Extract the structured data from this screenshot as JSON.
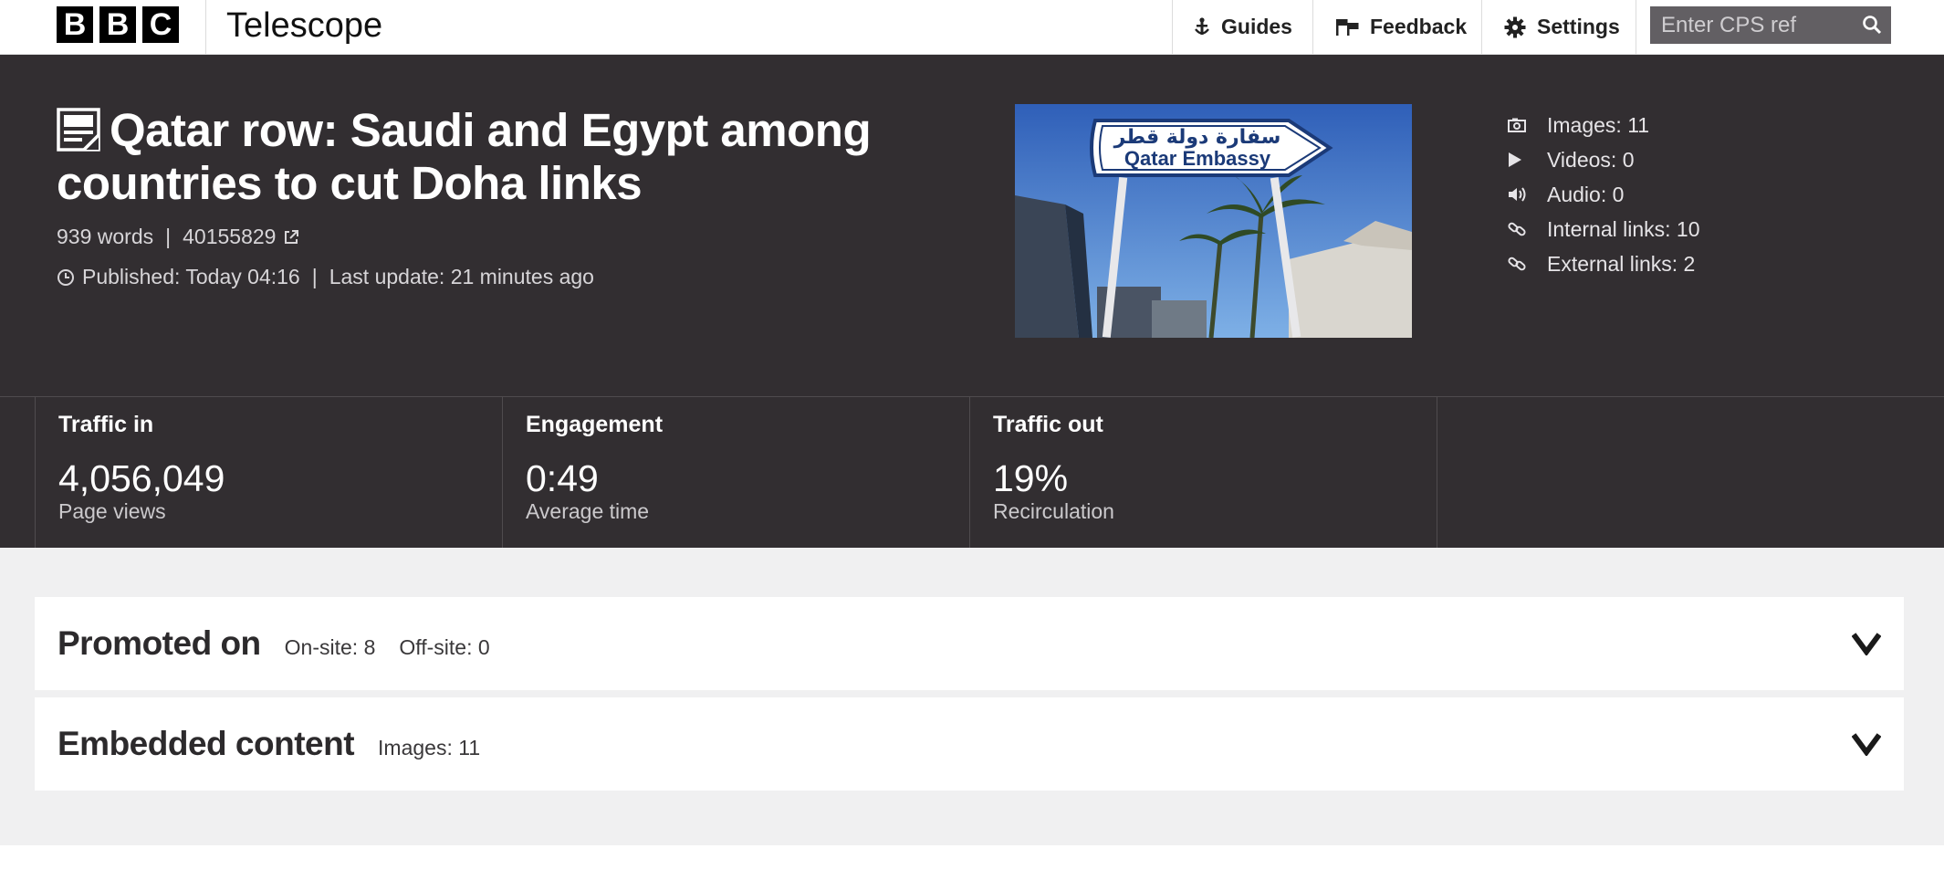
{
  "brand": {
    "letters": [
      "B",
      "B",
      "C"
    ],
    "app_name": "Telescope"
  },
  "nav": {
    "guides": {
      "label": "Guides",
      "icon": "guide-icon"
    },
    "feedback": {
      "label": "Feedback",
      "icon": "feedback-flags-icon"
    },
    "settings": {
      "label": "Settings",
      "icon": "gear-icon"
    }
  },
  "search": {
    "placeholder": "Enter CPS ref",
    "value": "",
    "icon": "search-icon"
  },
  "article": {
    "title": "Qatar row: Saudi and Egypt among countries to cut Doha links",
    "words": "939 words",
    "separator": "|",
    "asset_id": "40155829",
    "published": "Published: Today 04:16",
    "last_update": "Last update: 21 minutes ago",
    "image_sign_arabic": "سفارة دولة قطر",
    "image_sign_english": "Qatar Embassy"
  },
  "asset_stats": [
    {
      "icon": "camera-icon",
      "label": "Images: 11"
    },
    {
      "icon": "play-icon",
      "label": "Videos: 0"
    },
    {
      "icon": "speaker-icon",
      "label": "Audio: 0"
    },
    {
      "icon": "link-icon",
      "label": "Internal links: 10"
    },
    {
      "icon": "link-icon",
      "label": "External links: 2"
    }
  ],
  "metrics": [
    {
      "title": "Traffic in",
      "value": "4,056,049",
      "caption": "Page views"
    },
    {
      "title": "Engagement",
      "value": "0:49",
      "caption": "Average time"
    },
    {
      "title": "Traffic out",
      "value": "19%",
      "caption": "Recirculation"
    }
  ],
  "panels": {
    "promoted": {
      "title": "Promoted on",
      "onsite": "On-site: 8",
      "offsite": "Off-site: 0"
    },
    "embedded": {
      "title": "Embedded content",
      "images": "Images: 11"
    }
  },
  "colors": {
    "header_bg": "#322e31",
    "page_bg": "#f0f0f1",
    "search_bg": "#625f63"
  }
}
